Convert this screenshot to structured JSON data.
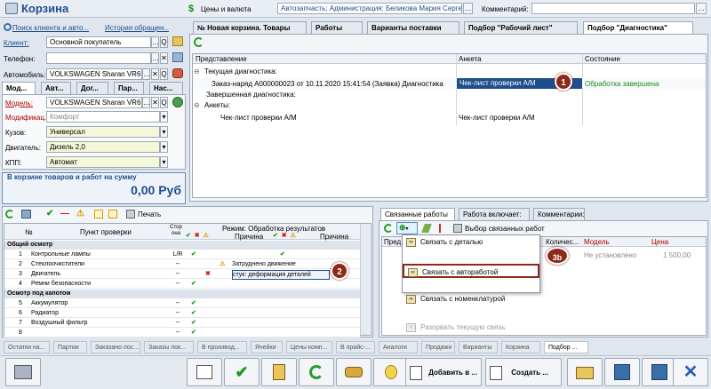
{
  "window": {
    "title": "Корзина",
    "currency_label": "Цены и валюта",
    "shop_info": "Автозапчасть; Администрация; Беликова Мария Сергеевна;",
    "comment_label": "Комментарий:"
  },
  "left": {
    "search_link": "Поиск клиента и авто...",
    "history_link": "История обращен...",
    "client_label": "Клиент:",
    "client_value": "Основной покупатель",
    "phone_label": "Телефон:",
    "phone_value": "",
    "car_label": "Автомобиль:",
    "car_value": "VOLKSWAGEN Sharan VR6 \"",
    "tabs": [
      "Мод...",
      "Авт...",
      "Дог...",
      "Пар...",
      "Нас..."
    ],
    "model_label": "Модель:",
    "model_value": "VOLKSWAGEN Sharan VR6",
    "mod_label": "Модификац.:",
    "mod_value": "Комфорт",
    "body_label": "Кузов:",
    "body_value": "Универсал",
    "engine_label": "Двигатель:",
    "engine_value": "Дизель 2,0",
    "gear_label": "КПП:",
    "gear_value": "Автомат",
    "sum_title": "В корзине товаров и работ на сумму",
    "sum_value": "0,00 Руб"
  },
  "top_tabs": [
    "№ Новая корзина. Товары",
    "Работы",
    "Варианты поставки",
    "Подбор \"Рабочий лист\"",
    "Подбор \"Диагностика\""
  ],
  "diag": {
    "columns": [
      "Представление",
      "Анкета",
      "Состояние"
    ],
    "rows": [
      {
        "name": "Текущая диагностика:",
        "anketa": "",
        "state": ""
      },
      {
        "name": "Заказ-наряд А000000023 от 10.11.2020 15:41:54 (Заявка) Диагностика",
        "anketa": "Чек-лист проверки А/М",
        "state": "Обработка завершена"
      },
      {
        "name": "Завершенная диагностика:",
        "anketa": "",
        "state": ""
      },
      {
        "name": "Анкеты:",
        "anketa": "",
        "state": ""
      },
      {
        "name": "Чек-лист проверки А/М",
        "anketa": "Чек-лист проверки А/М",
        "state": ""
      }
    ]
  },
  "check": {
    "print_label": "Печать",
    "col_num": "№",
    "col_point": "Пункт проверки",
    "col_side": "Стор она",
    "mode_label": "Режим: Обработка результатов",
    "col_reason": "Причина",
    "groups": [
      {
        "name": "Общий осмотр",
        "items": [
          {
            "n": "1",
            "name": "Контрольные лампы",
            "side": "L/R",
            "reason": ""
          },
          {
            "n": "2",
            "name": "Стеклоочистители",
            "side": "--",
            "reason": "Затруднено движение"
          },
          {
            "n": "3",
            "name": "Двигатель",
            "side": "--",
            "reason": "стук: деформация деталей"
          },
          {
            "n": "4",
            "name": "Ремни безопасности",
            "side": "--",
            "reason": ""
          }
        ]
      },
      {
        "name": "Осмотр под капотом",
        "items": [
          {
            "n": "5",
            "name": "Аккумулятор",
            "side": "--",
            "reason": ""
          },
          {
            "n": "6",
            "name": "Радиатор",
            "side": "--",
            "reason": ""
          },
          {
            "n": "7",
            "name": "Воздушный фильтр",
            "side": "--",
            "reason": ""
          },
          {
            "n": "8",
            "name": "",
            "side": "--",
            "reason": ""
          }
        ]
      }
    ]
  },
  "right": {
    "tabs": [
      "Связанные работы",
      "Работа включает:",
      "Комментарии:"
    ],
    "select_label": "Выбор связанных работ",
    "columns": [
      "Пред",
      "Количес...",
      "Модель",
      "Цена"
    ],
    "model_value": "Не установлено",
    "price_value": "1 500,00",
    "menu": [
      "Связать с деталью",
      "Связать с автоработой",
      "Связать с номенклатурой",
      "Разорвать текущую связь"
    ]
  },
  "bottom_tabs": [
    "Остатки на...",
    "Партии",
    "Заказано пос...",
    "Заказы пок...",
    "В производ...",
    "Ячейки",
    "Цены комп...",
    "В прайс-...",
    "Аналоги",
    "Продажи",
    "Варианты",
    "Корзина",
    "Подбор ..."
  ],
  "footer": {
    "add_label": "Добавить в ...",
    "create_label": "Создать ..."
  },
  "callouts": [
    "1",
    "2",
    "3b"
  ]
}
